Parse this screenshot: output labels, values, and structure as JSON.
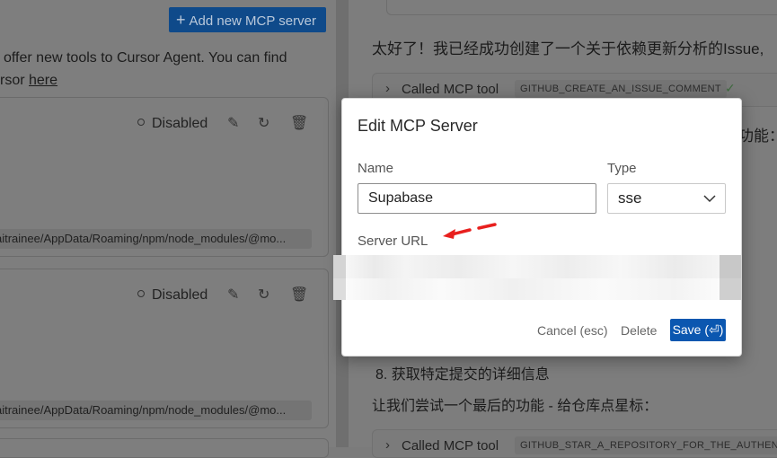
{
  "left": {
    "add_button_label": "Add new MCP server",
    "intro_line1": "offer new tools to Cursor Agent. You can find",
    "intro_line2_prefix": "rsor ",
    "intro_link": "here",
    "cards": [
      {
        "status": "Disabled",
        "path": "aitrainee/AppData/Roaming/npm/node_modules/@mo..."
      },
      {
        "status": "Disabled",
        "path": "aitrainee/AppData/Roaming/npm/node_modules/@mo..."
      }
    ]
  },
  "right": {
    "line_success": "太好了！我已经成功创建了一个关于依赖更新分析的Issue,",
    "tool_row_1": {
      "label": "Called MCP tool",
      "tag": "GITHUB_CREATE_AN_ISSUE_COMMENT"
    },
    "line_function_fragment": "功能：",
    "line_item_8": "8. 获取特定提交的详细信息",
    "line_try_last": "让我们尝试一个最后的功能 - 给仓库点星标：",
    "tool_row_2": {
      "label": "Called MCP tool",
      "tag": "GITHUB_STAR_A_REPOSITORY_FOR_THE_AUTHENTI"
    }
  },
  "modal": {
    "title": "Edit MCP Server",
    "name_label": "Name",
    "name_value": "Supabase",
    "type_label": "Type",
    "type_value": "sse",
    "url_label": "Server URL",
    "cancel_label": "Cancel (esc)",
    "delete_label": "Delete",
    "save_label": "Save (⏎)"
  },
  "colors": {
    "save_button": "#0b57b0",
    "add_button": "#0f4a8a",
    "annotation_arrow": "#e8201e"
  },
  "icons": [
    "plus-icon",
    "edit-icon",
    "refresh-icon",
    "trash-icon",
    "chevron-right-icon",
    "check-icon",
    "chevron-down-icon",
    "arrow-annotation-icon"
  ]
}
